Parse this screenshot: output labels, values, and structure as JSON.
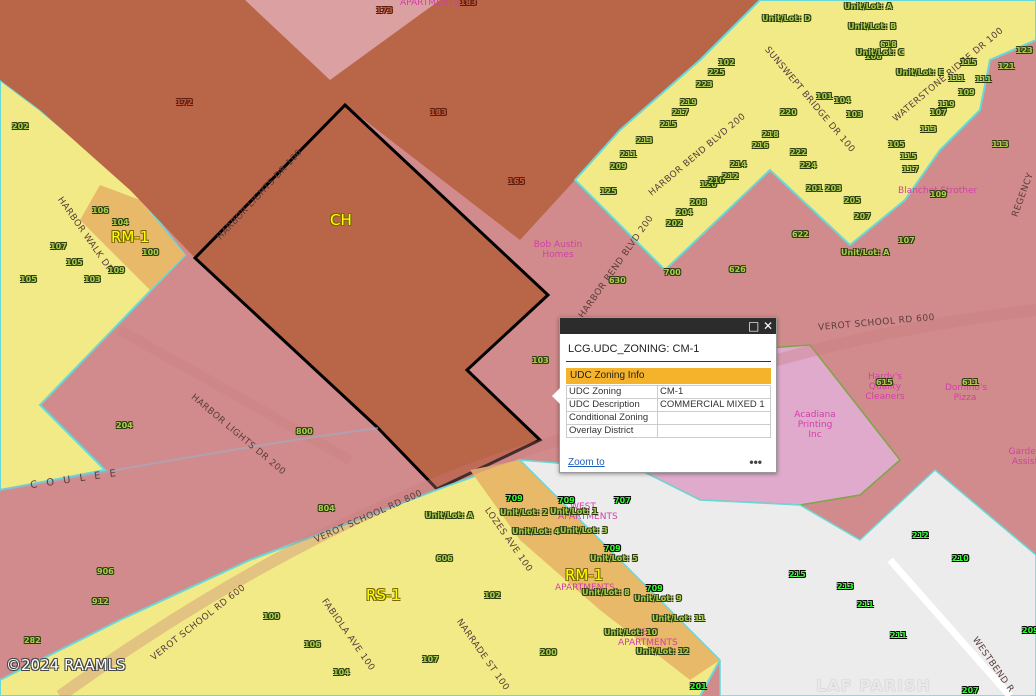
{
  "map": {
    "zones": [
      {
        "code": "CH"
      },
      {
        "code": "RM-1"
      },
      {
        "code": "RS-1"
      },
      {
        "code": "RM-1"
      }
    ],
    "roads": [
      "HARBOR LIGHTS DR 100",
      "HARBOR LIGHTS DR 200",
      "VEROT SCHOOL RD 600",
      "VEROT SCHOOL RD 800",
      "VEROT SCHOOL RD 600",
      "HARBOR WALK DR",
      "HARBOR BEND BLVD 200",
      "HARBOR BEND BLVD 200",
      "WATERSTONE RIDGE DR 100",
      "SUNSWEPT BRIDGE DR 100",
      "LOZES AVE 100",
      "FABIOLA AVE 100",
      "NARRADE ST 100",
      "WESTBEND R",
      "REGENCY",
      "C O U L E E"
    ],
    "pois": [
      {
        "name": "APARTMENTS"
      },
      {
        "name": "Bob Austin Homes"
      },
      {
        "name": "Blanchet Strother"
      },
      {
        "name": "Hardy's Quality Cleaners"
      },
      {
        "name": "Domino's Pizza"
      },
      {
        "name": "Acadiana Printing Inc"
      },
      {
        "name": "Garden Assist"
      },
      {
        "name": "WEST APARTMENTS"
      },
      {
        "name": "APARTMENTS"
      },
      {
        "name": "WEST APARTMENTS"
      }
    ],
    "addresses": {
      "dark": [
        "173",
        "183",
        "172",
        "183",
        "165"
      ],
      "green": [
        "202",
        "105",
        "103",
        "107",
        "104",
        "100",
        "106",
        "109",
        "105",
        "204",
        "800",
        "804",
        "912",
        "906",
        "282",
        "606",
        "102",
        "100",
        "200",
        "104",
        "107",
        "106",
        "120",
        "202",
        "204",
        "208",
        "210",
        "212",
        "214",
        "216",
        "218",
        "220",
        "222",
        "224",
        "101",
        "103",
        "105",
        "107",
        "109",
        "111",
        "113",
        "115",
        "117",
        "119",
        "121",
        "123",
        "125",
        "201",
        "203",
        "205",
        "207",
        "209",
        "211",
        "213",
        "215",
        "217",
        "219",
        "223",
        "225",
        "102",
        "104",
        "106",
        "618",
        "622",
        "626",
        "630",
        "700",
        "103",
        "107",
        "109",
        "111",
        "113",
        "115",
        "615",
        "611"
      ],
      "unit_labels": [
        "Unit/Lot: A",
        "Unit/Lot: D",
        "Unit/Lot: B",
        "Unit/Lot: C",
        "Unit/Lot: E",
        "Unit/Lot: A",
        "Unit/Lot: 1",
        "Unit/Lot: 2",
        "Unit/Lot: 3",
        "Unit/Lot: 4",
        "Unit/Lot: 5",
        "Unit/Lot: 8",
        "Unit/Lot: 9",
        "Unit/Lot: 10",
        "Unit/Lot: 11",
        "Unit/Lot: 12",
        "Unit/Lot: A"
      ],
      "bright": [
        "709",
        "707",
        "709",
        "709",
        "709",
        "212",
        "210",
        "215",
        "213",
        "211",
        "211",
        "209",
        "207",
        "201"
      ]
    },
    "copyright": "©2024 RAAMLS",
    "parish": "LAF PARISH"
  },
  "popup": {
    "title": "LCG.UDC_ZONING: CM-1",
    "section": "UDC Zoning Info",
    "rows": [
      {
        "key": "UDC Zoning",
        "value": "CM-1"
      },
      {
        "key": "UDC Description",
        "value": "COMMERCIAL MIXED 1"
      },
      {
        "key": "Conditional Zoning",
        "value": ""
      },
      {
        "key": "Overlay District",
        "value": ""
      }
    ],
    "zoom_label": "Zoom to",
    "more_label": "•••",
    "maximize_icon": "maximize-icon",
    "close_icon": "close-icon"
  },
  "colors": {
    "ch": "#b96548",
    "cm1": "#d18b8c",
    "rs1": "#f2ea86",
    "rm1": "#e7b968",
    "cx": "#dfaacb",
    "civic": "#ececec",
    "outline": "#69d8d6",
    "selection": "#000000",
    "popup_section": "#f5b22b"
  }
}
